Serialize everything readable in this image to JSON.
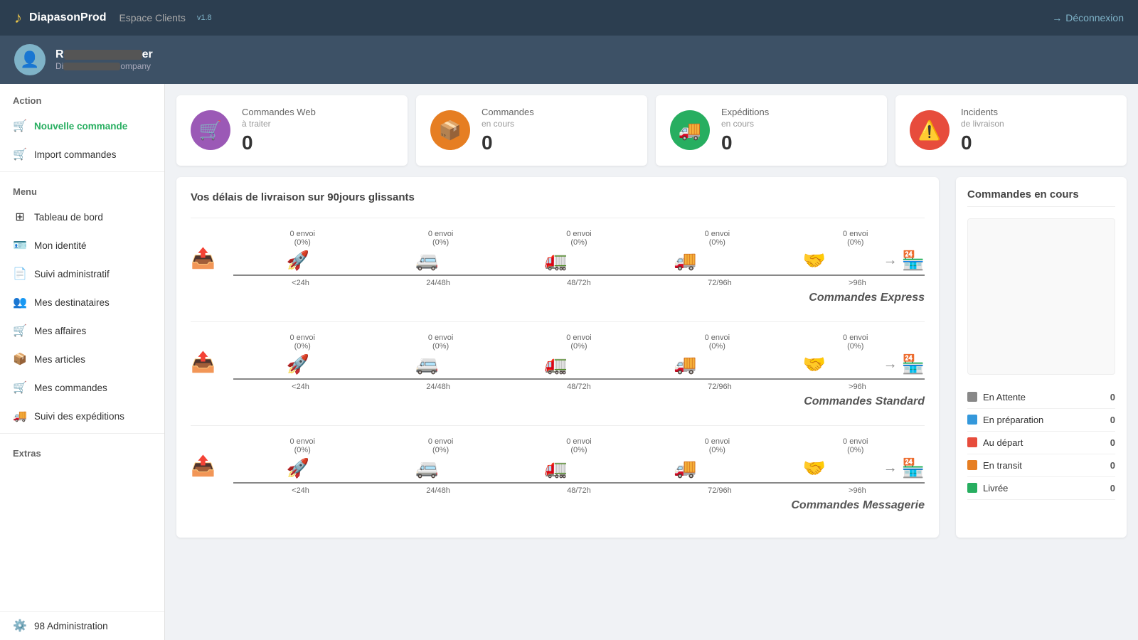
{
  "header": {
    "logo": "♪",
    "app_name": "DiapasonProd",
    "separator": "|",
    "space": "Espace Clients",
    "version": "v1.8",
    "logout_label": "Déconnexion"
  },
  "user": {
    "name_prefix": "R",
    "name_suffix": "er",
    "company_prefix": "Di",
    "company_suffix": "ompany",
    "avatar_icon": "👤"
  },
  "sidebar": {
    "action_title": "Action",
    "action_items": [
      {
        "id": "nouvelle-commande",
        "label": "Nouvelle commande",
        "icon": "🛒",
        "active": true
      },
      {
        "id": "import-commandes",
        "label": "Import commandes",
        "icon": "🛒",
        "active": false
      }
    ],
    "menu_title": "Menu",
    "menu_items": [
      {
        "id": "tableau-de-bord",
        "label": "Tableau de bord",
        "icon": "⊞"
      },
      {
        "id": "mon-identite",
        "label": "Mon identité",
        "icon": "🪪"
      },
      {
        "id": "suivi-administratif",
        "label": "Suivi administratif",
        "icon": "📄"
      },
      {
        "id": "mes-destinataires",
        "label": "Mes destinataires",
        "icon": "👥"
      },
      {
        "id": "mes-affaires",
        "label": "Mes affaires",
        "icon": "🛒"
      },
      {
        "id": "mes-articles",
        "label": "Mes articles",
        "icon": "📦"
      },
      {
        "id": "mes-commandes",
        "label": "Mes commandes",
        "icon": "🛒"
      },
      {
        "id": "suivi-des-expeditions",
        "label": "Suivi des expéditions",
        "icon": "🚚"
      }
    ],
    "extras_title": "Extras",
    "extras_items": [
      {
        "id": "administration",
        "label": "Administration",
        "icon": "⚙️",
        "badge": "98"
      }
    ]
  },
  "stat_cards": [
    {
      "id": "commandes-web",
      "label": "Commandes Web",
      "sublabel": "à traiter",
      "value": "0",
      "icon": "🛒",
      "color": "purple"
    },
    {
      "id": "commandes-en-cours",
      "label": "Commandes",
      "sublabel": "en cours",
      "value": "0",
      "icon": "📦",
      "color": "orange"
    },
    {
      "id": "expeditions",
      "label": "Expéditions",
      "sublabel": "en cours",
      "value": "0",
      "icon": "🚚",
      "color": "green"
    },
    {
      "id": "incidents",
      "label": "Incidents",
      "sublabel": "de livraison",
      "value": "0",
      "icon": "⚠️",
      "color": "red"
    }
  ],
  "delivery_section": {
    "title": "Vos délais de livraison sur 90jours glissants",
    "rows": [
      {
        "type_label": "Commandes Express",
        "steps": [
          {
            "label": "<24h",
            "stat": "0 envoi",
            "pct": "(0%)",
            "icon_color": "green"
          },
          {
            "label": "24/48h",
            "stat": "0 envoi",
            "pct": "(0%)",
            "icon_color": "purple"
          },
          {
            "label": "48/72h",
            "stat": "0 envoi",
            "pct": "(0%)",
            "icon_color": "blue"
          },
          {
            "label": "72/96h",
            "stat": "0 envoi",
            "pct": "(0%)",
            "icon_color": "orange"
          },
          {
            "label": ">96h",
            "stat": "0 envoi",
            "pct": "(0%)",
            "icon_color": "red"
          }
        ]
      },
      {
        "type_label": "Commandes Standard",
        "steps": [
          {
            "label": "<24h",
            "stat": "0 envoi",
            "pct": "(0%)",
            "icon_color": "green"
          },
          {
            "label": "24/48h",
            "stat": "0 envoi",
            "pct": "(0%)",
            "icon_color": "purple"
          },
          {
            "label": "48/72h",
            "stat": "0 envoi",
            "pct": "(0%)",
            "icon_color": "blue"
          },
          {
            "label": "72/96h",
            "stat": "0 envoi",
            "pct": "(0%)",
            "icon_color": "orange"
          },
          {
            "label": ">96h",
            "stat": "0 envoi",
            "pct": "(0%)",
            "icon_color": "red"
          }
        ]
      },
      {
        "type_label": "Commandes Messagerie",
        "steps": [
          {
            "label": "<24h",
            "stat": "0 envoi",
            "pct": "(0%)",
            "icon_color": "green"
          },
          {
            "label": "24/48h",
            "stat": "0 envoi",
            "pct": "(0%)",
            "icon_color": "purple"
          },
          {
            "label": "48/72h",
            "stat": "0 envoi",
            "pct": "(0%)",
            "icon_color": "blue"
          },
          {
            "label": "72/96h",
            "stat": "0 envoi",
            "pct": "(0%)",
            "icon_color": "orange"
          },
          {
            "label": ">96h",
            "stat": "0 envoi",
            "pct": "(0%)",
            "icon_color": "red"
          }
        ]
      }
    ]
  },
  "orders_panel": {
    "title": "Commandes en cours",
    "statuses": [
      {
        "id": "en-attente",
        "label": "En Attente",
        "color": "grey",
        "count": "0"
      },
      {
        "id": "en-preparation",
        "label": "En préparation",
        "color": "blue",
        "count": "0"
      },
      {
        "id": "au-depart",
        "label": "Au départ",
        "color": "red",
        "count": "0"
      },
      {
        "id": "en-transit",
        "label": "En transit",
        "color": "orange",
        "count": "0"
      },
      {
        "id": "livree",
        "label": "Livrée",
        "color": "green",
        "count": "0"
      }
    ]
  },
  "icons": {
    "step_icons": {
      "green": "🚀",
      "purple": "🚐",
      "blue": "🚛",
      "orange": "🚚",
      "red": "🤝"
    },
    "end_icon": "🏪"
  }
}
